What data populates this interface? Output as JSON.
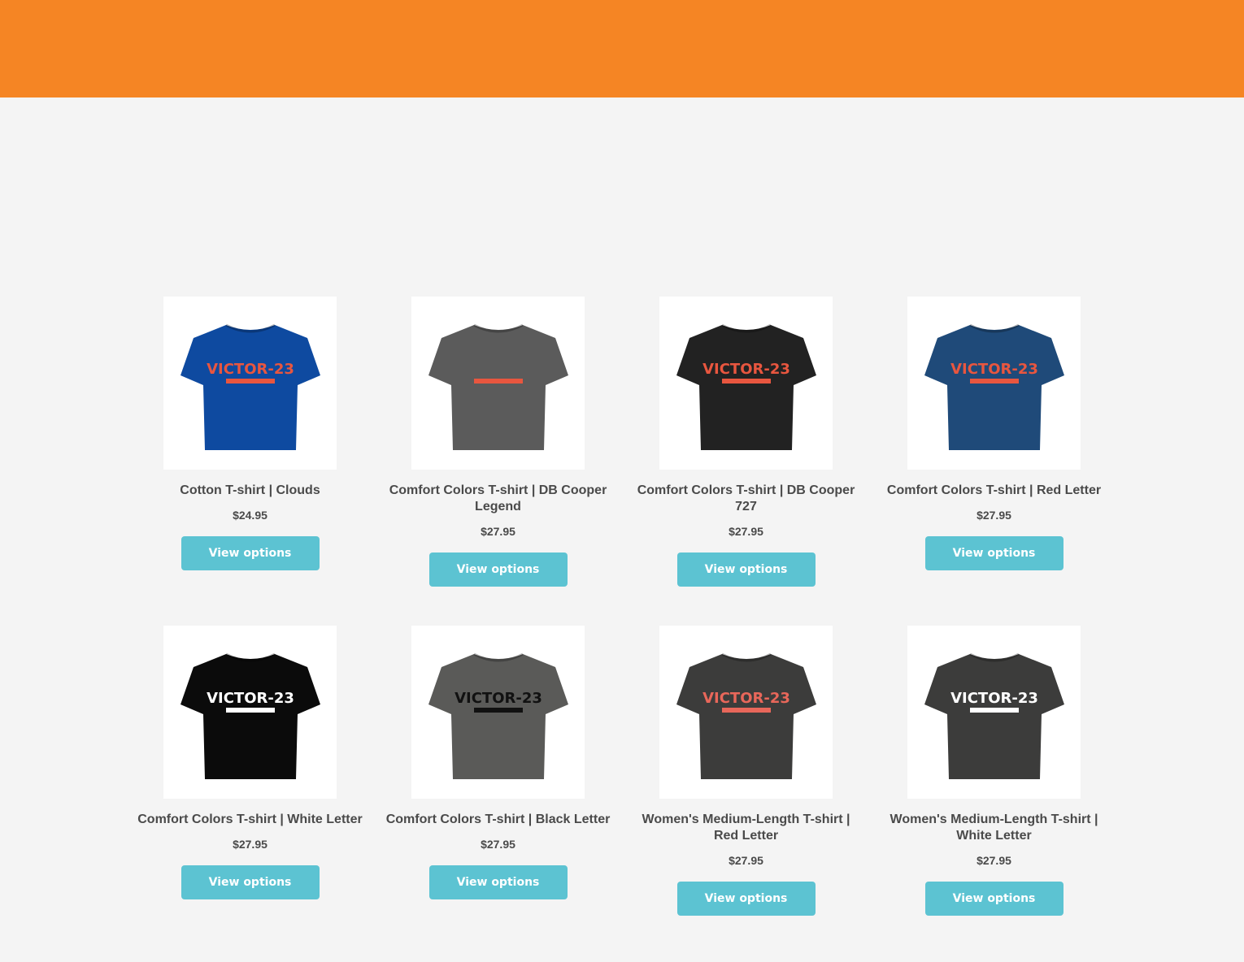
{
  "products": [
    {
      "title": "Cotton T-shirt | Clouds",
      "price": "$24.95",
      "button": "View options",
      "image_icon": "tshirt-icon",
      "shirt_color": "#0e4aa0",
      "logo_color": "#e8563f",
      "logo_text": "VICTOR-23"
    },
    {
      "title": "Comfort Colors T-shirt | DB Cooper Legend",
      "price": "$27.95",
      "button": "View options",
      "image_icon": "tshirt-icon",
      "shirt_color": "#5b5b5b",
      "logo_color": "#e8563f",
      "logo_text": ""
    },
    {
      "title": "Comfort Colors T-shirt | DB Cooper 727",
      "price": "$27.95",
      "button": "View options",
      "image_icon": "tshirt-icon",
      "shirt_color": "#222222",
      "logo_color": "#e8563f",
      "logo_text": "VICTOR-23"
    },
    {
      "title": "Comfort Colors T-shirt | Red Letter",
      "price": "$27.95",
      "button": "View options",
      "image_icon": "tshirt-icon",
      "shirt_color": "#1f4a79",
      "logo_color": "#e8563f",
      "logo_text": "VICTOR-23"
    },
    {
      "title": "Comfort Colors T-shirt | White Letter",
      "price": "$27.95",
      "button": "View options",
      "image_icon": "tshirt-icon",
      "shirt_color": "#0b0b0b",
      "logo_color": "#ffffff",
      "logo_text": "VICTOR-23"
    },
    {
      "title": "Comfort Colors T-shirt | Black Letter",
      "price": "$27.95",
      "button": "View options",
      "image_icon": "tshirt-icon",
      "shirt_color": "#5a5a58",
      "logo_color": "#111111",
      "logo_text": "VICTOR-23"
    },
    {
      "title": "Women's Medium-Length T-shirt | Red Letter",
      "price": "$27.95",
      "button": "View options",
      "image_icon": "tshirt-icon",
      "shirt_color": "#3c3c3b",
      "logo_color": "#e8675a",
      "logo_text": "VICTOR-23"
    },
    {
      "title": "Women's Medium-Length T-shirt | White Letter",
      "price": "$27.95",
      "button": "View options",
      "image_icon": "tshirt-icon",
      "shirt_color": "#3c3c3b",
      "logo_color": "#ffffff",
      "logo_text": "VICTOR-23"
    }
  ],
  "colors": {
    "header": "#f58524",
    "button": "#5cc3d2",
    "background": "#f4f4f4"
  }
}
